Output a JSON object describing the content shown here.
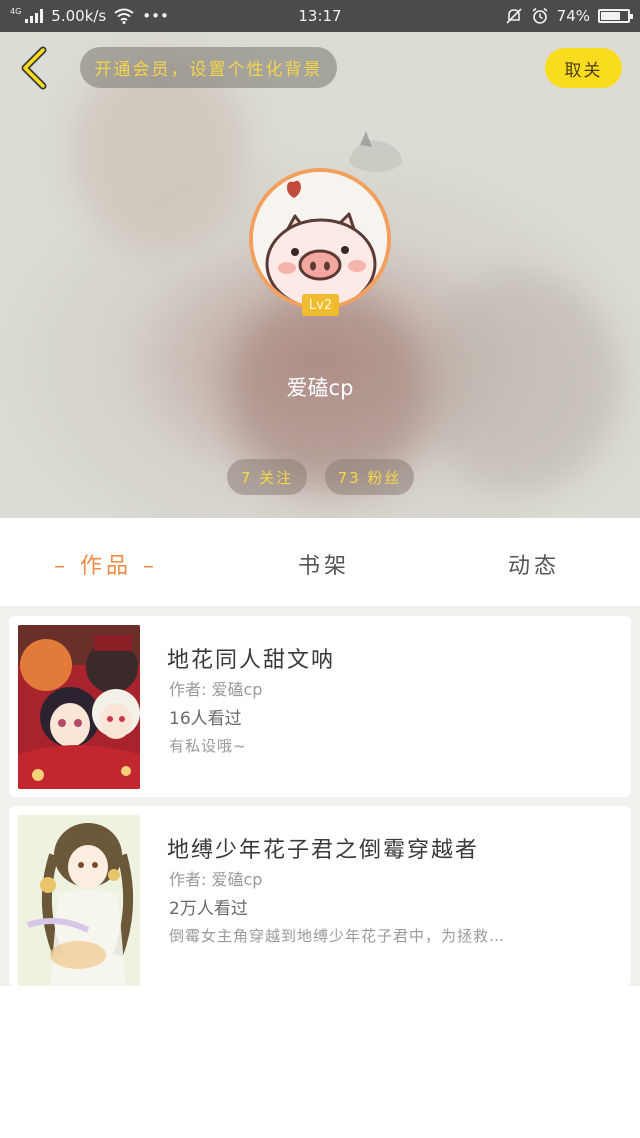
{
  "status_bar": {
    "network_tag": "4G",
    "speed": "5.00k/s",
    "more_dots": "•••",
    "time": "13:17",
    "battery_level": "74%",
    "battery_fraction": 0.74
  },
  "header": {
    "vip_banner": "开通会员，设置个性化背景",
    "unfollow_label": "取关",
    "level_badge": "Lv2",
    "username": "爱磕cp",
    "following": "7 关注",
    "followers": "73 粉丝"
  },
  "tabs": [
    {
      "label": "作品",
      "active": true
    },
    {
      "label": "书架",
      "active": false
    },
    {
      "label": "动态",
      "active": false
    }
  ],
  "works": [
    {
      "title": "地花同人甜文呐",
      "author": "作者: 爱磕cp",
      "views": "16人看过",
      "description": "有私设哦~"
    },
    {
      "title": "地缚少年花子君之倒霉穿越者",
      "author": "作者: 爱磕cp",
      "views": "2万人看过",
      "description": "倒霉女主角穿越到地缚少年花子君中，为拯救…"
    }
  ],
  "colors": {
    "accent_orange": "#f08a46",
    "accent_yellow": "#f8dc1d",
    "pill_text_yellow": "#f5d54a",
    "status_bar_bg": "#4b4b4b"
  }
}
